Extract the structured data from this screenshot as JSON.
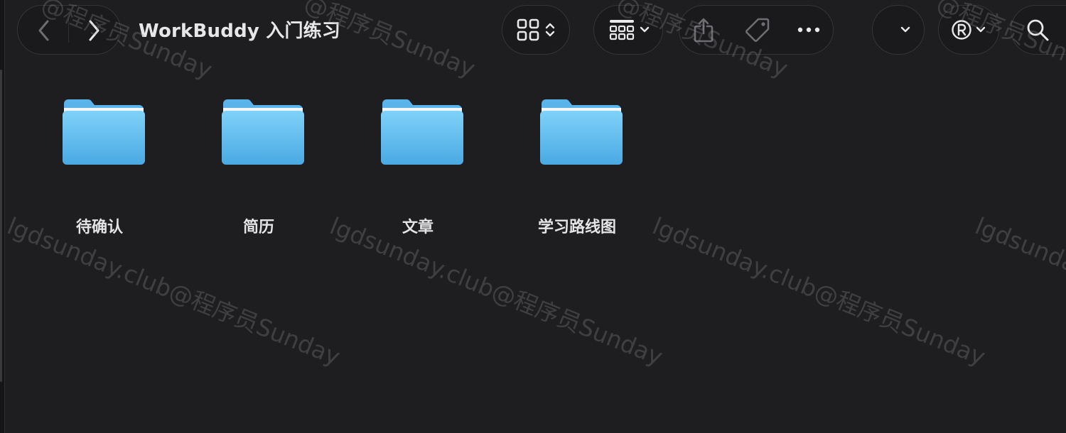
{
  "window": {
    "title": "WorkBuddy 入门练习"
  },
  "toolbar": {
    "nav": {
      "back_icon": "chevron-left-icon",
      "forward_icon": "chevron-right-icon"
    },
    "view_icon": "grid-view-icon",
    "group_icon": "group-by-icon",
    "share_icon": "share-icon",
    "tag_icon": "tag-icon",
    "more_icon": "more-icon",
    "dropdown_icon": "chevron-down-icon",
    "registered_icon": "registered-icon",
    "search_icon": "search-icon"
  },
  "folders": [
    {
      "name": "待确认"
    },
    {
      "name": "简历"
    },
    {
      "name": "文章"
    },
    {
      "name": "学习路线图"
    }
  ],
  "watermark": {
    "text": "lgdsunday.club@程序员Sunday",
    "short_text": "@程序员Sunday"
  },
  "colors": {
    "background": "#1e1e20",
    "folder_top": "#7fd2f9",
    "folder_bottom": "#4aa9e3",
    "text": "#e4e4e6",
    "icon": "#e8e8ea"
  }
}
